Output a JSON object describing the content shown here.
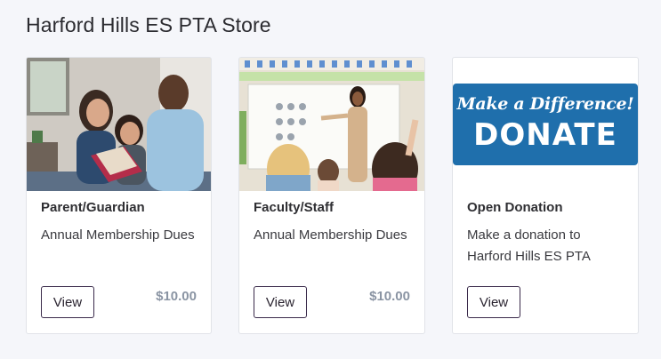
{
  "store": {
    "title": "Harford Hills ES PTA Store"
  },
  "products": [
    {
      "title": "Parent/Guardian",
      "description": "Annual Membership Dues",
      "button_label": "View",
      "price": "$10.00",
      "image": "family-reading-photo"
    },
    {
      "title": "Faculty/Staff",
      "description": "Annual Membership Dues",
      "button_label": "View",
      "price": "$10.00",
      "image": "classroom-teacher-photo"
    },
    {
      "title": "Open Donation",
      "description": "Make a donation to Harford Hills ES PTA",
      "button_label": "View",
      "image": "donate-banner",
      "banner": {
        "line1": "Make a Difference!",
        "line2": "DONATE"
      }
    }
  ],
  "colors": {
    "background": "#f5f6fa",
    "price": "#8a94a3",
    "donate_blue": "#1f6fac",
    "button_border": "#3a2a4a"
  }
}
